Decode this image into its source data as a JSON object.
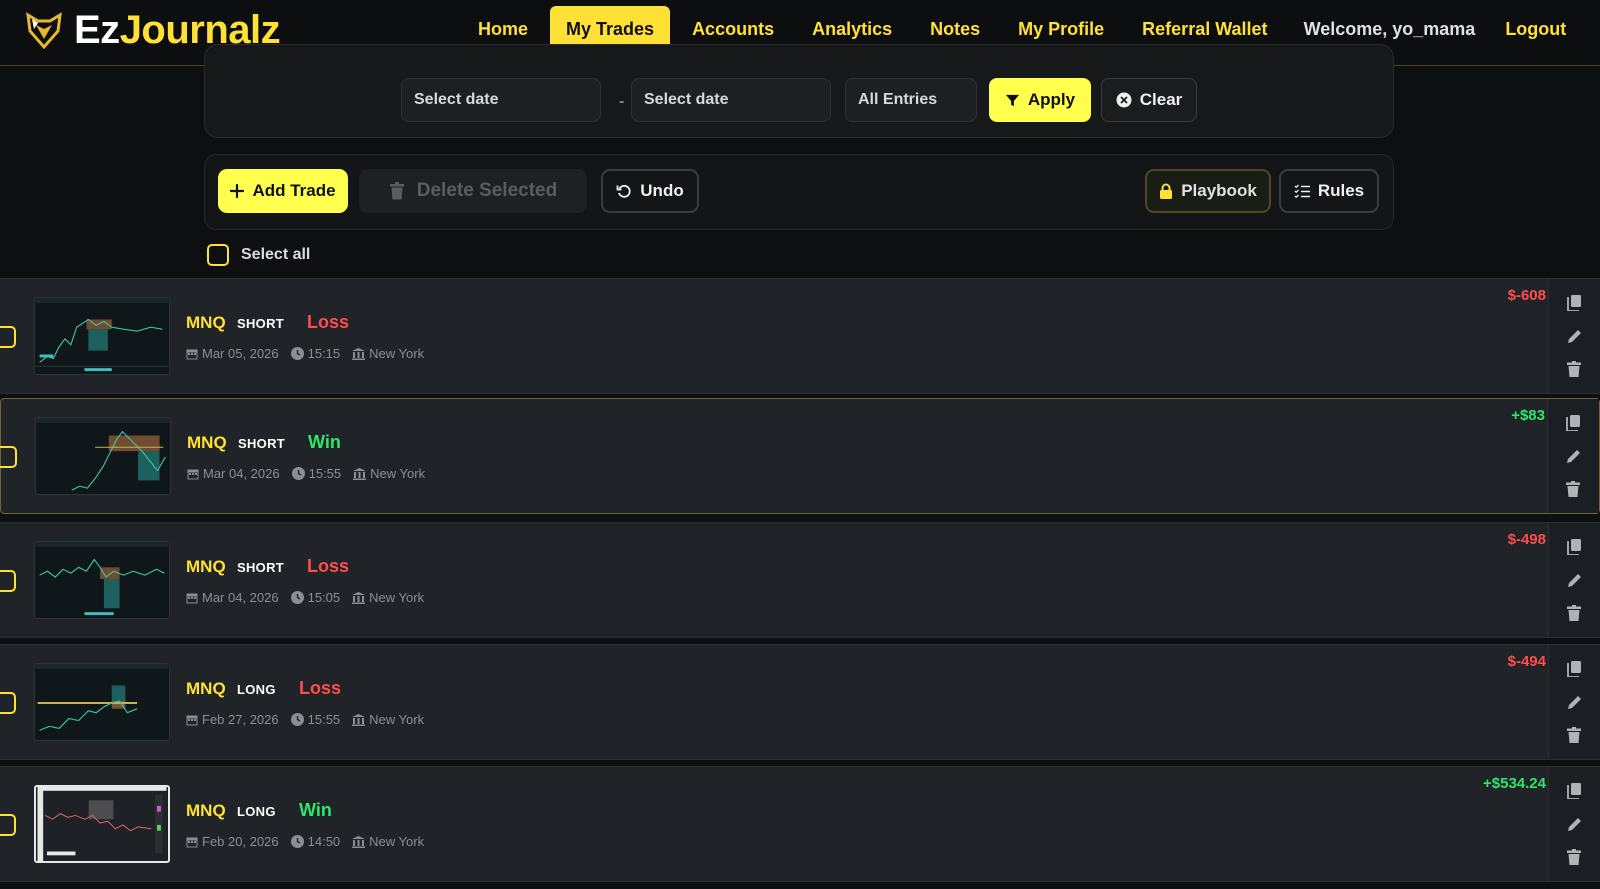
{
  "brand": {
    "part1": "Ez",
    "part2": "Journalz"
  },
  "nav": {
    "links": [
      "Home",
      "My Trades",
      "Accounts",
      "Analytics",
      "Notes",
      "My Profile",
      "Referral Wallet"
    ],
    "active": "My Trades",
    "welcome": "Welcome, yo_mama",
    "logout": "Logout"
  },
  "filters": {
    "start_date_placeholder": "Select date",
    "separator": "-",
    "end_date_placeholder": "Select date",
    "entries_select": "All Entries",
    "apply_label": "Apply",
    "clear_label": "Clear"
  },
  "toolbar": {
    "add_label": "Add Trade",
    "delete_label": "Delete Selected",
    "undo_label": "Undo",
    "playbook_label": "Playbook",
    "rules_label": "Rules"
  },
  "select_all_label": "Select all",
  "colors": {
    "accent": "#ffe135",
    "loss": "#ff4d4d",
    "win": "#2ee66b",
    "row_bg": "#202327",
    "page_bg": "#0e0f10"
  },
  "trades": [
    {
      "symbol": "MNQ",
      "direction": "SHORT",
      "result": "Loss",
      "date": "Mar 05, 2026",
      "time": "15:15",
      "session": "New York",
      "pnl": "$-608"
    },
    {
      "symbol": "MNQ",
      "direction": "SHORT",
      "result": "Win",
      "date": "Mar 04, 2026",
      "time": "15:55",
      "session": "New York",
      "pnl": "+$83"
    },
    {
      "symbol": "MNQ",
      "direction": "SHORT",
      "result": "Loss",
      "date": "Mar 04, 2026",
      "time": "15:05",
      "session": "New York",
      "pnl": "$-498"
    },
    {
      "symbol": "MNQ",
      "direction": "LONG",
      "result": "Loss",
      "date": "Feb 27, 2026",
      "time": "15:55",
      "session": "New York",
      "pnl": "$-494"
    },
    {
      "symbol": "MNQ",
      "direction": "LONG",
      "result": "Win",
      "date": "Feb 20, 2026",
      "time": "14:50",
      "session": "New York",
      "pnl": "+$534.24"
    }
  ]
}
